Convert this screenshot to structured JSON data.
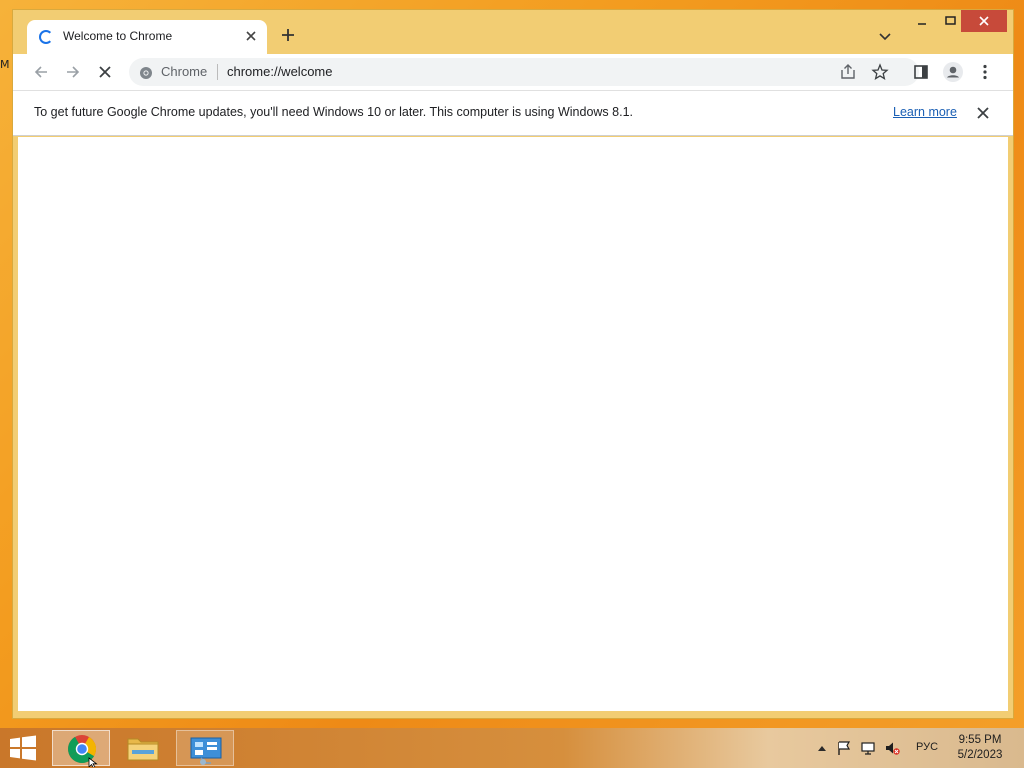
{
  "desktop": {
    "icon_fragment": "M"
  },
  "browser": {
    "tab": {
      "title": "Welcome to Chrome",
      "loading": true
    },
    "toolbar": {
      "site_chip": "Chrome",
      "url": "chrome://welcome"
    },
    "infobar": {
      "message": "To get future Google Chrome updates, you'll need Windows 10 or later. This computer is using Windows 8.1.",
      "link_label": "Learn more"
    }
  },
  "taskbar": {
    "apps": [
      {
        "name": "Google Chrome",
        "icon": "chrome-icon",
        "state": "active"
      },
      {
        "name": "File Explorer",
        "icon": "folder-icon",
        "state": "pinned"
      },
      {
        "name": "Control Panel",
        "icon": "control-panel-icon",
        "state": "pinned"
      }
    ],
    "tray": {
      "language": "РУС",
      "time": "9:55 PM",
      "date": "5/2/2023"
    }
  },
  "colors": {
    "accent": "#1a73e8",
    "window_frame": "#f2cd73",
    "close_button": "#c74a3a",
    "link": "#1a5fb4"
  }
}
